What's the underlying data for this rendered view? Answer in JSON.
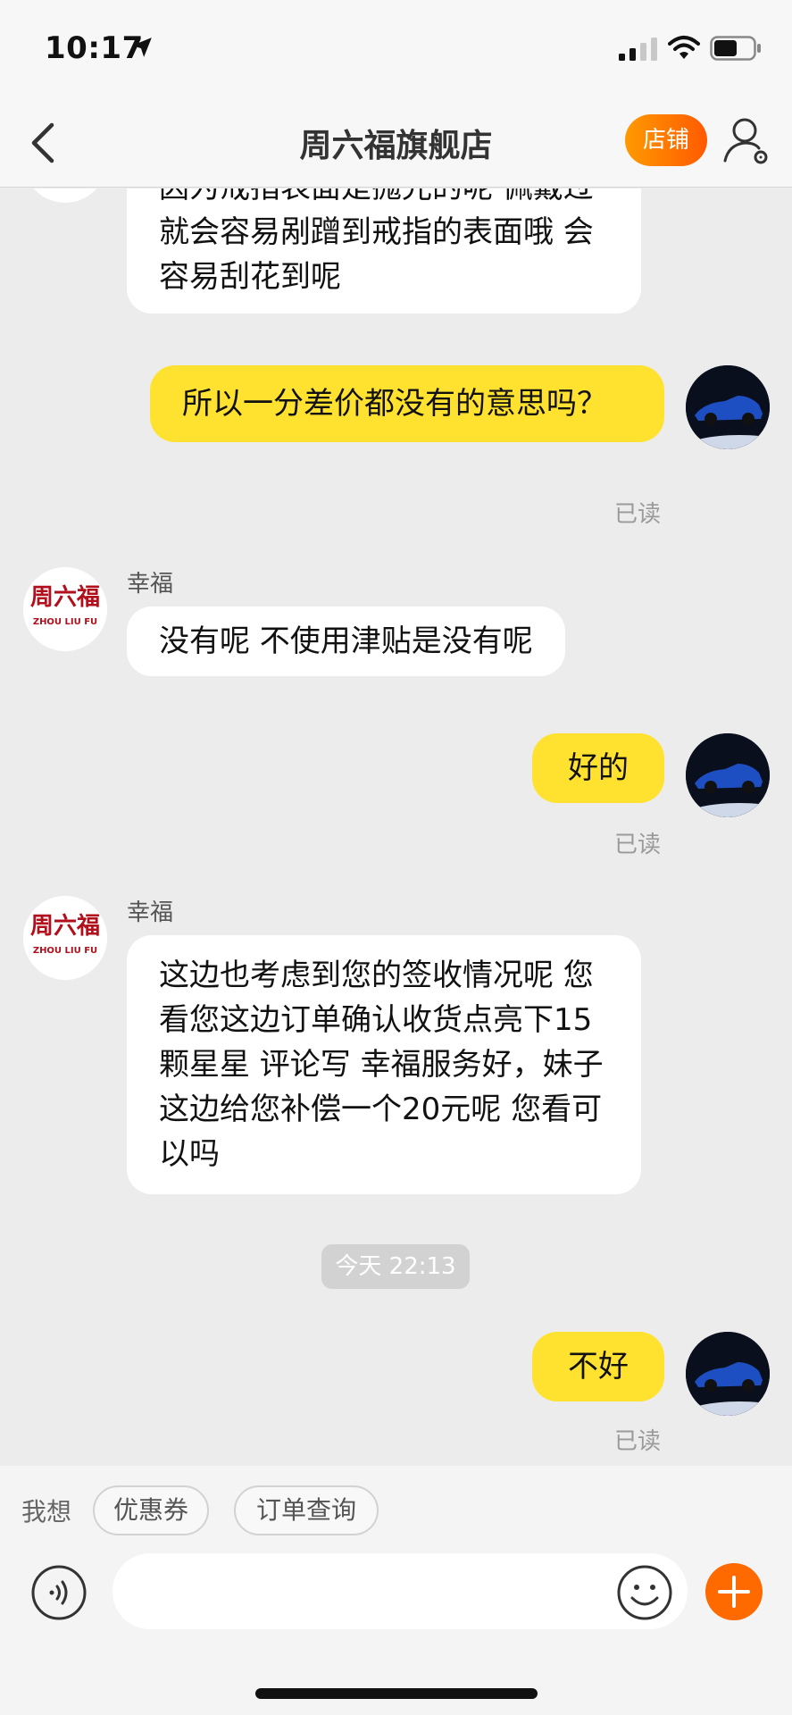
{
  "status_bar": {
    "time": "10:17"
  },
  "header": {
    "title": "周六福旗舰店",
    "store_button": "店铺"
  },
  "messages": [
    {
      "text": "因为戒指表面是抛光的呢 佩戴过就会容易剐蹭到戒指的表面哦 会容易刮花到呢"
    },
    {
      "text": "所以一分差价都没有的意思吗？",
      "status": "已读"
    },
    {
      "sender": "幸福",
      "text": "没有呢 不使用津贴是没有呢"
    },
    {
      "text": "好的",
      "status": "已读"
    },
    {
      "sender": "幸福",
      "text": "这边也考虑到您的签收情况呢 您看您这边订单确认收货点亮下15颗星星 评论写 幸福服务好，妹子这边给您补偿一个20元呢 您看可以吗"
    },
    {
      "text": "不好",
      "status": "已读"
    }
  ],
  "timestamp": "今天 22:13",
  "shop_avatar": {
    "name_cn": "周六福",
    "name_en": "ZHOU LIU FU"
  },
  "quick_bar": {
    "label": "我想",
    "chips": [
      "优惠券",
      "订单查询"
    ]
  },
  "input": {
    "value": "",
    "placeholder": ""
  },
  "colors": {
    "accent": "#ff6a00",
    "bubble_self": "#ffe22f",
    "bubble_other": "#ffffff",
    "background": "#ececec"
  },
  "icons": [
    "location-arrow-icon",
    "signal-icon",
    "wifi-icon",
    "battery-icon",
    "back-chevron-icon",
    "user-settings-icon",
    "voice-icon",
    "emoji-icon",
    "plus-icon"
  ]
}
